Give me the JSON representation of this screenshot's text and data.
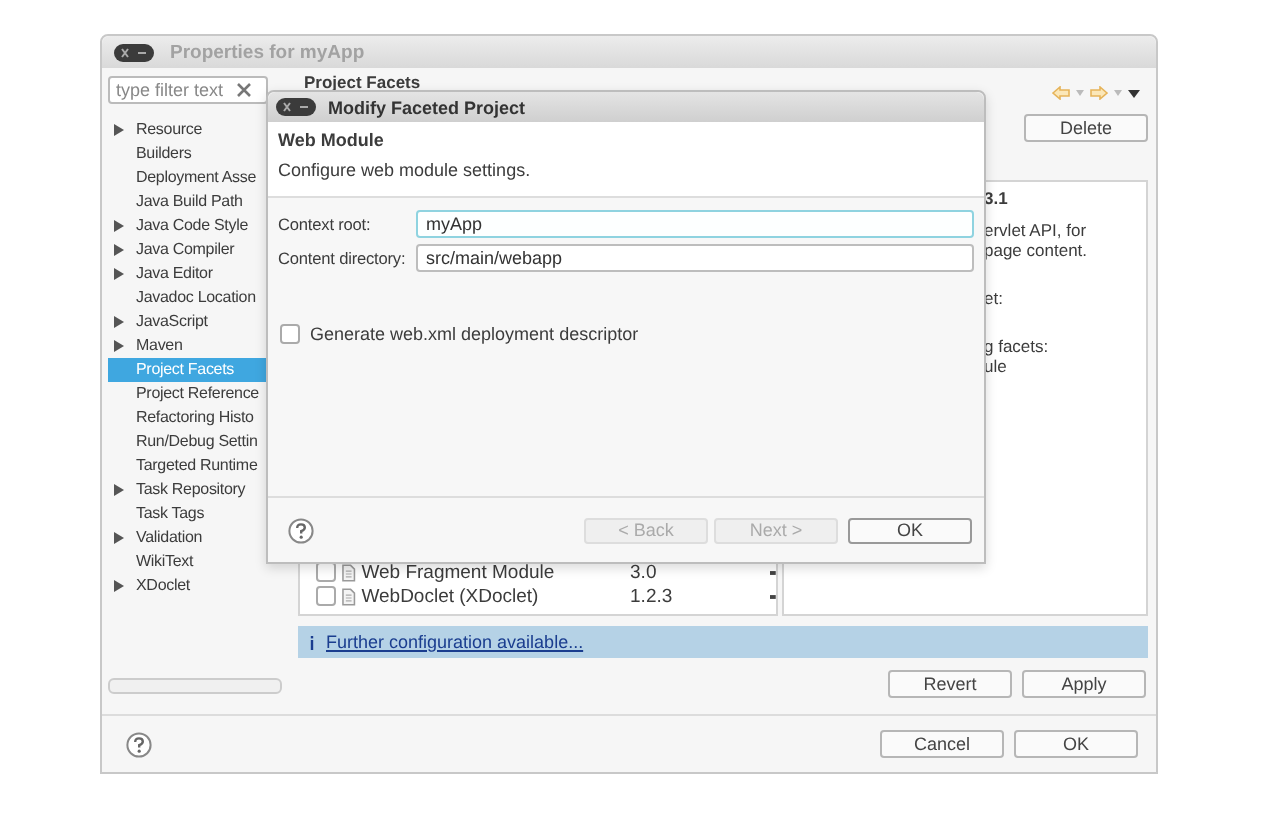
{
  "window": {
    "title": "Properties for myApp"
  },
  "filter": {
    "placeholder": "type filter text"
  },
  "tree": [
    {
      "label": "Resource",
      "expandable": true,
      "selected": false
    },
    {
      "label": "Builders",
      "expandable": false,
      "selected": false
    },
    {
      "label": "Deployment Asse",
      "expandable": false,
      "selected": false
    },
    {
      "label": "Java Build Path",
      "expandable": false,
      "selected": false
    },
    {
      "label": "Java Code Style",
      "expandable": true,
      "selected": false
    },
    {
      "label": "Java Compiler",
      "expandable": true,
      "selected": false
    },
    {
      "label": "Java Editor",
      "expandable": true,
      "selected": false
    },
    {
      "label": "Javadoc Location",
      "expandable": false,
      "selected": false
    },
    {
      "label": "JavaScript",
      "expandable": true,
      "selected": false
    },
    {
      "label": "Maven",
      "expandable": true,
      "selected": false
    },
    {
      "label": "Project Facets",
      "expandable": false,
      "selected": true
    },
    {
      "label": "Project Reference",
      "expandable": false,
      "selected": false
    },
    {
      "label": "Refactoring Histo",
      "expandable": false,
      "selected": false
    },
    {
      "label": "Run/Debug Settin",
      "expandable": false,
      "selected": false
    },
    {
      "label": "Targeted Runtime",
      "expandable": false,
      "selected": false
    },
    {
      "label": "Task Repository",
      "expandable": true,
      "selected": false
    },
    {
      "label": "Task Tags",
      "expandable": false,
      "selected": false
    },
    {
      "label": "Validation",
      "expandable": true,
      "selected": false
    },
    {
      "label": "WikiText",
      "expandable": false,
      "selected": false
    },
    {
      "label": "XDoclet",
      "expandable": true,
      "selected": false
    }
  ],
  "page": {
    "title": "Project Facets",
    "buttons": [
      "Delete"
    ]
  },
  "details": [
    {
      "kind": "heading",
      "text": "3.1"
    },
    {
      "kind": "text",
      "text": "ervlet API, for"
    },
    {
      "kind": "text",
      "text": "page content."
    },
    {
      "kind": "label",
      "text": "et:"
    },
    {
      "kind": "label",
      "text": "g facets:"
    },
    {
      "kind": "text",
      "text": "ule"
    }
  ],
  "facets": [
    {
      "name": "Web Fragment Module",
      "version": "3.0",
      "checked": false
    },
    {
      "name": "WebDoclet (XDoclet)",
      "version": "1.2.3",
      "checked": false
    }
  ],
  "info": {
    "link": "Further configuration available..."
  },
  "page_buttons": [
    "Revert",
    "Apply"
  ],
  "dialog_buttons": [
    "Cancel",
    "OK"
  ],
  "modal": {
    "title": "Modify Faceted Project",
    "heading": "Web Module",
    "description": "Configure web module settings.",
    "fields": [
      {
        "label": "Context root:",
        "value": "myApp",
        "focused": true
      },
      {
        "label": "Content directory:",
        "value": "src/main/webapp",
        "focused": false
      }
    ],
    "checkbox": {
      "label": "Generate web.xml deployment descriptor",
      "checked": false
    },
    "buttons": [
      {
        "label": "< Back",
        "disabled": true
      },
      {
        "label": "Next >",
        "disabled": true
      },
      {
        "label": "OK",
        "disabled": false
      }
    ]
  }
}
